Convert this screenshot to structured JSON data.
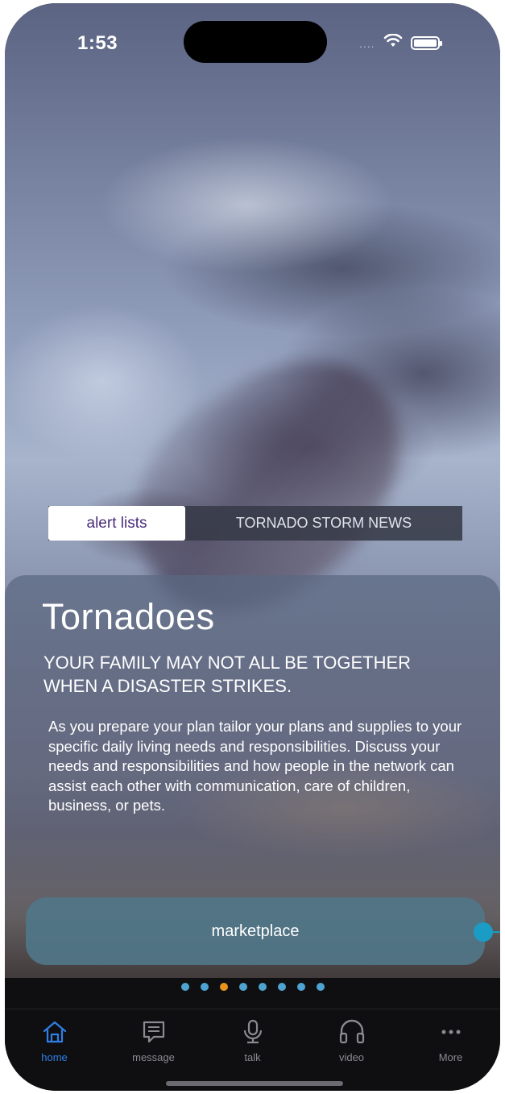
{
  "status_bar": {
    "time": "1:53",
    "signal": "....",
    "wifi_icon": "wifi-icon",
    "battery_icon": "battery-icon"
  },
  "segments": {
    "active": "alert lists",
    "inactive": "TORNADO STORM NEWS"
  },
  "card": {
    "title": "Tornadoes",
    "subtitle": "YOUR FAMILY MAY NOT ALL BE TOGETHER WHEN A DISASTER STRIKES.",
    "body": "As you prepare your plan tailor your plans and supplies to your specific daily living needs and responsibilities. Discuss your needs and responsibilities and how people in the network can assist each other with communication, care of children, business, or pets."
  },
  "marketplace": {
    "label": "marketplace"
  },
  "page_indicator": {
    "total": 8,
    "current": 3
  },
  "tabbar": {
    "items": [
      {
        "label": "home",
        "icon": "home-icon",
        "active": true
      },
      {
        "label": "message",
        "icon": "message-icon",
        "active": false
      },
      {
        "label": "talk",
        "icon": "microphone-icon",
        "active": false
      },
      {
        "label": "video",
        "icon": "headphones-icon",
        "active": false
      },
      {
        "label": "More",
        "icon": "more-icon",
        "active": false
      }
    ]
  },
  "colors": {
    "active_tab": "#2f7fe6",
    "inactive_tab": "#8a8a90",
    "dot": "#4fa3d1",
    "dot_active": "#e8931b",
    "segment_active_text": "#4a2d7a",
    "connector": "#1b9cc4"
  }
}
